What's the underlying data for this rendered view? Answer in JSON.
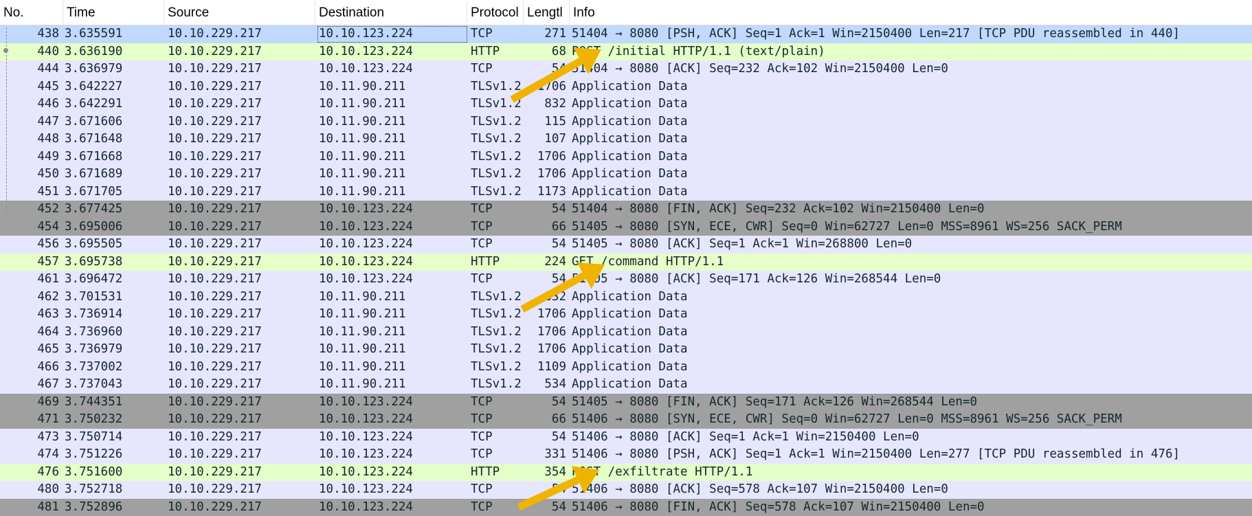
{
  "columns": {
    "no": "No.",
    "time": "Time",
    "source": "Source",
    "destination": "Destination",
    "protocol": "Protocol",
    "length": "Lengtl",
    "info": "Info"
  },
  "colors": {
    "tcp_row": "#e7e6ff",
    "http_row": "#e4ffc7",
    "fin_row": "#a0a0a0",
    "selected_row": "#bfd9ff",
    "annotation_arrow": "#f0b400"
  },
  "annotation_icons": [
    "arrow-icon",
    "arrow-icon",
    "arrow-icon"
  ],
  "packets": [
    {
      "no": "438",
      "time": "3.635591",
      "src": "10.10.229.217",
      "dst": "10.10.123.224",
      "proto": "TCP",
      "len": "271",
      "info": "51404 → 8080 [PSH, ACK] Seq=1 Ack=1 Win=2150400 Len=217 [TCP PDU reassembled in 440]",
      "kind": "sel"
    },
    {
      "no": "440",
      "time": "3.636190",
      "src": "10.10.229.217",
      "dst": "10.10.123.224",
      "proto": "HTTP",
      "len": "68",
      "info": "POST /initial HTTP/1.1  (text/plain)",
      "kind": "http"
    },
    {
      "no": "444",
      "time": "3.636979",
      "src": "10.10.229.217",
      "dst": "10.10.123.224",
      "proto": "TCP",
      "len": "54",
      "info": "51404 → 8080 [ACK] Seq=232 Ack=102 Win=2150400 Len=0",
      "kind": "tcp"
    },
    {
      "no": "445",
      "time": "3.642227",
      "src": "10.10.229.217",
      "dst": "10.11.90.211",
      "proto": "TLSv1.2",
      "len": "1706",
      "info": "Application Data",
      "kind": "tls"
    },
    {
      "no": "446",
      "time": "3.642291",
      "src": "10.10.229.217",
      "dst": "10.11.90.211",
      "proto": "TLSv1.2",
      "len": "832",
      "info": "Application Data",
      "kind": "tls"
    },
    {
      "no": "447",
      "time": "3.671606",
      "src": "10.10.229.217",
      "dst": "10.11.90.211",
      "proto": "TLSv1.2",
      "len": "115",
      "info": "Application Data",
      "kind": "tls"
    },
    {
      "no": "448",
      "time": "3.671648",
      "src": "10.10.229.217",
      "dst": "10.11.90.211",
      "proto": "TLSv1.2",
      "len": "107",
      "info": "Application Data",
      "kind": "tls"
    },
    {
      "no": "449",
      "time": "3.671668",
      "src": "10.10.229.217",
      "dst": "10.11.90.211",
      "proto": "TLSv1.2",
      "len": "1706",
      "info": "Application Data",
      "kind": "tls"
    },
    {
      "no": "450",
      "time": "3.671689",
      "src": "10.10.229.217",
      "dst": "10.11.90.211",
      "proto": "TLSv1.2",
      "len": "1706",
      "info": "Application Data",
      "kind": "tls"
    },
    {
      "no": "451",
      "time": "3.671705",
      "src": "10.10.229.217",
      "dst": "10.11.90.211",
      "proto": "TLSv1.2",
      "len": "1173",
      "info": "Application Data",
      "kind": "tls"
    },
    {
      "no": "452",
      "time": "3.677425",
      "src": "10.10.229.217",
      "dst": "10.10.123.224",
      "proto": "TCP",
      "len": "54",
      "info": "51404 → 8080 [FIN, ACK] Seq=232 Ack=102 Win=2150400 Len=0",
      "kind": "fin"
    },
    {
      "no": "454",
      "time": "3.695006",
      "src": "10.10.229.217",
      "dst": "10.10.123.224",
      "proto": "TCP",
      "len": "66",
      "info": "51405 → 8080 [SYN, ECE, CWR] Seq=0 Win=62727 Len=0 MSS=8961 WS=256 SACK_PERM",
      "kind": "fin"
    },
    {
      "no": "456",
      "time": "3.695505",
      "src": "10.10.229.217",
      "dst": "10.10.123.224",
      "proto": "TCP",
      "len": "54",
      "info": "51405 → 8080 [ACK] Seq=1 Ack=1 Win=268800 Len=0",
      "kind": "tcp"
    },
    {
      "no": "457",
      "time": "3.695738",
      "src": "10.10.229.217",
      "dst": "10.10.123.224",
      "proto": "HTTP",
      "len": "224",
      "info": "GET /command HTTP/1.1",
      "kind": "http"
    },
    {
      "no": "461",
      "time": "3.696472",
      "src": "10.10.229.217",
      "dst": "10.10.123.224",
      "proto": "TCP",
      "len": "54",
      "info": "51405 → 8080 [ACK] Seq=171 Ack=126 Win=268544 Len=0",
      "kind": "tcp"
    },
    {
      "no": "462",
      "time": "3.701531",
      "src": "10.10.229.217",
      "dst": "10.11.90.211",
      "proto": "TLSv1.2",
      "len": "832",
      "info": "Application Data",
      "kind": "tls"
    },
    {
      "no": "463",
      "time": "3.736914",
      "src": "10.10.229.217",
      "dst": "10.11.90.211",
      "proto": "TLSv1.2",
      "len": "1706",
      "info": "Application Data",
      "kind": "tls"
    },
    {
      "no": "464",
      "time": "3.736960",
      "src": "10.10.229.217",
      "dst": "10.11.90.211",
      "proto": "TLSv1.2",
      "len": "1706",
      "info": "Application Data",
      "kind": "tls"
    },
    {
      "no": "465",
      "time": "3.736979",
      "src": "10.10.229.217",
      "dst": "10.11.90.211",
      "proto": "TLSv1.2",
      "len": "1706",
      "info": "Application Data",
      "kind": "tls"
    },
    {
      "no": "466",
      "time": "3.737002",
      "src": "10.10.229.217",
      "dst": "10.11.90.211",
      "proto": "TLSv1.2",
      "len": "1109",
      "info": "Application Data",
      "kind": "tls"
    },
    {
      "no": "467",
      "time": "3.737043",
      "src": "10.10.229.217",
      "dst": "10.11.90.211",
      "proto": "TLSv1.2",
      "len": "534",
      "info": "Application Data",
      "kind": "tls"
    },
    {
      "no": "469",
      "time": "3.744351",
      "src": "10.10.229.217",
      "dst": "10.10.123.224",
      "proto": "TCP",
      "len": "54",
      "info": "51405 → 8080 [FIN, ACK] Seq=171 Ack=126 Win=268544 Len=0",
      "kind": "fin"
    },
    {
      "no": "471",
      "time": "3.750232",
      "src": "10.10.229.217",
      "dst": "10.10.123.224",
      "proto": "TCP",
      "len": "66",
      "info": "51406 → 8080 [SYN, ECE, CWR] Seq=0 Win=62727 Len=0 MSS=8961 WS=256 SACK_PERM",
      "kind": "fin"
    },
    {
      "no": "473",
      "time": "3.750714",
      "src": "10.10.229.217",
      "dst": "10.10.123.224",
      "proto": "TCP",
      "len": "54",
      "info": "51406 → 8080 [ACK] Seq=1 Ack=1 Win=2150400 Len=0",
      "kind": "tcp"
    },
    {
      "no": "474",
      "time": "3.751226",
      "src": "10.10.229.217",
      "dst": "10.10.123.224",
      "proto": "TCP",
      "len": "331",
      "info": "51406 → 8080 [PSH, ACK] Seq=1 Ack=1 Win=2150400 Len=277 [TCP PDU reassembled in 476]",
      "kind": "tcp"
    },
    {
      "no": "476",
      "time": "3.751600",
      "src": "10.10.229.217",
      "dst": "10.10.123.224",
      "proto": "HTTP",
      "len": "354",
      "info": "POST /exfiltrate HTTP/1.1",
      "kind": "http"
    },
    {
      "no": "480",
      "time": "3.752718",
      "src": "10.10.229.217",
      "dst": "10.10.123.224",
      "proto": "TCP",
      "len": "54",
      "info": "51406 → 8080 [ACK] Seq=578 Ack=107 Win=2150400 Len=0",
      "kind": "tcp"
    },
    {
      "no": "481",
      "time": "3.752896",
      "src": "10.10.229.217",
      "dst": "10.10.123.224",
      "proto": "TCP",
      "len": "54",
      "info": "51406 → 8080 [FIN, ACK] Seq=578 Ack=107 Win=2150400 Len=0",
      "kind": "fin"
    }
  ]
}
